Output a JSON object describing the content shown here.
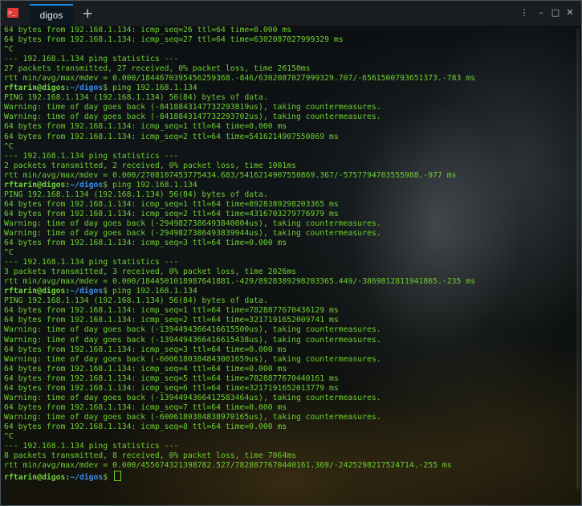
{
  "window": {
    "tab_label": "digos",
    "new_tab_glyph": "+",
    "controls": {
      "settings": "⋮",
      "minimize": "–",
      "maximize": "□",
      "close": "✕"
    },
    "app_icon_glyph": ">_"
  },
  "prompt": {
    "user_host": "rftarin@digos",
    "path_sep": ":",
    "path": "~/digos",
    "symbol": "$"
  },
  "colors": {
    "output": "#6fcf2f",
    "prompt_user": "#72d63a",
    "prompt_path": "#3b8eea",
    "tab_accent": "#1e88e5"
  },
  "lines": [
    {
      "t": "o",
      "text": "64 bytes from 192.168.1.134: icmp_seq=26 ttl=64 time=0.000 ms"
    },
    {
      "t": "o",
      "text": "64 bytes from 192.168.1.134: icmp_seq=27 ttl=64 time=6302087027999329 ms"
    },
    {
      "t": "o",
      "text": "^C"
    },
    {
      "t": "o",
      "text": "--- 192.168.1.134 ping statistics ---"
    },
    {
      "t": "o",
      "text": "27 packets transmitted, 27 received, 0% packet loss, time 26150ms"
    },
    {
      "t": "o",
      "text": "rtt min/avg/max/mdev = 0.000/1844670395456259368.-846/6302087027999329.707/-6561500793651373.-783 ms"
    },
    {
      "t": "p",
      "cmd": " ping 192.168.1.134"
    },
    {
      "t": "o",
      "text": "PING 192.168.1.134 (192.168.1.134) 56(84) bytes of data."
    },
    {
      "t": "o",
      "text": "Warning: time of day goes back (-8418843147732293819us), taking countermeasures."
    },
    {
      "t": "o",
      "text": "Warning: time of day goes back (-8418843147732293702us), taking countermeasures."
    },
    {
      "t": "o",
      "text": "64 bytes from 192.168.1.134: icmp_seq=1 ttl=64 time=0.000 ms"
    },
    {
      "t": "o",
      "text": "64 bytes from 192.168.1.134: icmp_seq=2 ttl=64 time=5416214907550869 ms"
    },
    {
      "t": "o",
      "text": "^C"
    },
    {
      "t": "o",
      "text": "--- 192.168.1.134 ping statistics ---"
    },
    {
      "t": "o",
      "text": "2 packets transmitted, 2 received, 0% packet loss, time 1001ms"
    },
    {
      "t": "o",
      "text": "rtt min/avg/max/mdev = 0.000/2708107453775434.683/5416214907550869.367/-5757794703555988.-977 ms"
    },
    {
      "t": "p",
      "cmd": " ping 192.168.1.134"
    },
    {
      "t": "o",
      "text": "PING 192.168.1.134 (192.168.1.134) 56(84) bytes of data."
    },
    {
      "t": "o",
      "text": "64 bytes from 192.168.1.134: icmp_seq=1 ttl=64 time=8928389298203365 ms"
    },
    {
      "t": "o",
      "text": "64 bytes from 192.168.1.134: icmp_seq=2 ttl=64 time=4316703279776979 ms"
    },
    {
      "t": "o",
      "text": "Warning: time of day goes back (-2949827386493840004us), taking countermeasures."
    },
    {
      "t": "o",
      "text": "Warning: time of day goes back (-2949827386493839944us), taking countermeasures."
    },
    {
      "t": "o",
      "text": "64 bytes from 192.168.1.134: icmp_seq=3 ttl=64 time=0.000 ms"
    },
    {
      "t": "o",
      "text": "^C"
    },
    {
      "t": "o",
      "text": "--- 192.168.1.134 ping statistics ---"
    },
    {
      "t": "o",
      "text": "3 packets transmitted, 3 received, 0% packet loss, time 2026ms"
    },
    {
      "t": "o",
      "text": "rtt min/avg/max/mdev = 0.000/1844501018987641881.-429/8928389298203365.449/-3869812811941865.-235 ms"
    },
    {
      "t": "p",
      "cmd": " ping 192.168.1.134"
    },
    {
      "t": "o",
      "text": "PING 192.168.1.134 (192.168.1.134) 56(84) bytes of data."
    },
    {
      "t": "o",
      "text": "64 bytes from 192.168.1.134: icmp_seq=1 ttl=64 time=7828877670436129 ms"
    },
    {
      "t": "o",
      "text": "64 bytes from 192.168.1.134: icmp_seq=2 ttl=64 time=3217191652009741 ms"
    },
    {
      "t": "o",
      "text": "Warning: time of day goes back (-1394494366416615500us), taking countermeasures."
    },
    {
      "t": "o",
      "text": "Warning: time of day goes back (-1394494366416615438us), taking countermeasures."
    },
    {
      "t": "o",
      "text": "64 bytes from 192.168.1.134: icmp_seq=3 ttl=64 time=0.000 ms"
    },
    {
      "t": "o",
      "text": "Warning: time of day goes back (-6006180384843001659us), taking countermeasures."
    },
    {
      "t": "o",
      "text": "64 bytes from 192.168.1.134: icmp_seq=4 ttl=64 time=0.000 ms"
    },
    {
      "t": "o",
      "text": "64 bytes from 192.168.1.134: icmp_seq=5 ttl=64 time=7828877670440161 ms"
    },
    {
      "t": "o",
      "text": "64 bytes from 192.168.1.134: icmp_seq=6 ttl=64 time=3217191652013779 ms"
    },
    {
      "t": "o",
      "text": "Warning: time of day goes back (-1394494366412583464us), taking countermeasures."
    },
    {
      "t": "o",
      "text": "64 bytes from 192.168.1.134: icmp_seq=7 ttl=64 time=0.000 ms"
    },
    {
      "t": "o",
      "text": "Warning: time of day goes back (-6006180384838970165us), taking countermeasures."
    },
    {
      "t": "o",
      "text": "64 bytes from 192.168.1.134: icmp_seq=8 ttl=64 time=0.000 ms"
    },
    {
      "t": "o",
      "text": "^C"
    },
    {
      "t": "o",
      "text": "--- 192.168.1.134 ping statistics ---"
    },
    {
      "t": "o",
      "text": "8 packets transmitted, 8 received, 0% packet loss, time 7064ms"
    },
    {
      "t": "o",
      "text": "rtt min/avg/max/mdev = 0.000/455674321398782.527/7828877670440161.369/-2425298217524714.-255 ms"
    },
    {
      "t": "p",
      "cmd": " ",
      "cursor": true
    }
  ]
}
